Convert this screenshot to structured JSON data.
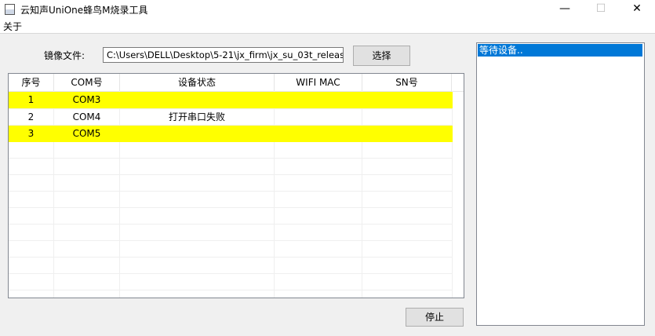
{
  "window": {
    "title": "云知声UniOne蜂鸟M烧录工具",
    "controls": {
      "minimize": "—",
      "maximize": "☐",
      "close": "✕"
    }
  },
  "menu": {
    "about": "关于"
  },
  "image_file": {
    "label": "镜像文件:",
    "path": "C:\\Users\\DELL\\Desktop\\5-21\\jx_firm\\jx_su_03t_releas",
    "select_button": "选择"
  },
  "table": {
    "columns": [
      "序号",
      "COM号",
      "设备状态",
      "WIFI MAC",
      "SN号"
    ],
    "rows": [
      {
        "index": "1",
        "com": "COM3",
        "status": "",
        "mac": "",
        "sn": "",
        "highlight": true
      },
      {
        "index": "2",
        "com": "COM4",
        "status": "打开串口失败",
        "mac": "",
        "sn": "",
        "highlight": false
      },
      {
        "index": "3",
        "com": "COM5",
        "status": "",
        "mac": "",
        "sn": "",
        "highlight": true
      }
    ]
  },
  "stop_button": "停止",
  "log": {
    "lines": [
      "等待设备.."
    ]
  },
  "colors": {
    "highlight_row": "#ffff00",
    "selection": "#0078d7"
  }
}
